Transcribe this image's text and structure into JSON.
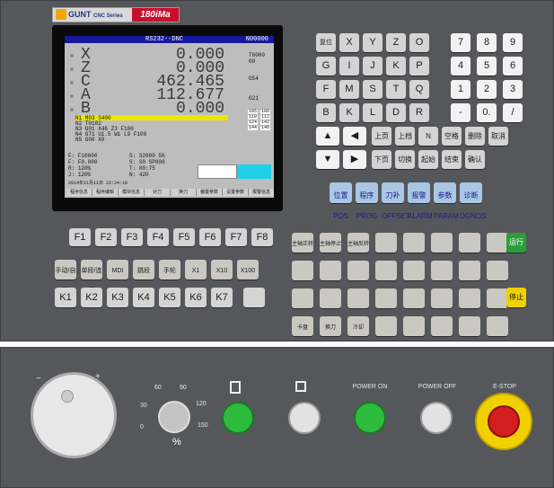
{
  "brand": {
    "maker": "GUNT",
    "series": "CNC Series",
    "model": "180iMa"
  },
  "screen": {
    "title": "RS232--DNC",
    "program": "N00000",
    "axes": [
      {
        "name": "X",
        "value": "0.000"
      },
      {
        "name": "Z",
        "value": "0.000"
      },
      {
        "name": "C",
        "value": "462.465"
      },
      {
        "name": "A",
        "value": "112.677"
      },
      {
        "name": "B",
        "value": "0.000"
      }
    ],
    "t_code": "T0000 00",
    "g54": "G54",
    "g21": "G21",
    "program_lines": [
      "N1 M03 S400",
      "N2 T0102",
      "N3 G01 X46 Z3 F100",
      "N4 G71 U1.5 W1 L9 F100",
      "N5 G00 X0"
    ],
    "m_codes": [
      "105",
      "106",
      "110",
      "112",
      "124",
      "142",
      "144",
      "146"
    ],
    "feed": "F10000",
    "feed2": "F0.000",
    "speed": "S2000",
    "speed2": "S0",
    "override": "5%",
    "spoverride": "SP000",
    "rapid": "120%",
    "jog": "120%",
    "time": "00:75",
    "parts": "420",
    "datetime": "2014年11月11日 22:24:10",
    "softkeys": [
      "程序信息",
      "程序编辑",
      "模块信息",
      "对刀",
      "换刀",
      "偏置参数",
      "设置参数",
      "报警信息"
    ]
  },
  "address_keys": [
    [
      "复位RESET",
      "X",
      "Y",
      "Z",
      "O",
      "7",
      "8",
      "9"
    ],
    [
      "G",
      "I",
      "J",
      "K",
      "P",
      "4",
      "5",
      "6"
    ],
    [
      "F",
      "M",
      "S",
      "T",
      "Q",
      "1",
      "2",
      "3"
    ],
    [
      "B",
      "K",
      "L",
      "D",
      "R",
      "-",
      "0.",
      "/"
    ]
  ],
  "edit_keys": [
    [
      "上页",
      "上档",
      "N",
      "空格",
      "删除",
      "取消"
    ],
    [
      "下页",
      "切换",
      "起始",
      "结束",
      "确认"
    ]
  ],
  "func_keys": [
    "位置POS",
    "程序PROG",
    "刀补OFFSET",
    "报警ALARM",
    "参数PARAM",
    "诊断DGNOS"
  ],
  "fkeys": [
    "F1",
    "F2",
    "F3",
    "F4",
    "F5",
    "F6",
    "F7",
    "F8"
  ],
  "mode_keys": [
    "手动/自动",
    "单段/连续",
    "MDI",
    "跳段",
    "手轮",
    "X1",
    "X10",
    "X100"
  ],
  "kkeys": [
    "K1",
    "K2",
    "K3",
    "K4",
    "K5",
    "K6",
    "K7"
  ],
  "machine_keys": [
    "主轴正转",
    "主轴停止",
    "主轴反转",
    "运行",
    "停止",
    "卡盘",
    "换刀",
    "冷却"
  ],
  "bottom": {
    "override_label": "%",
    "scale": [
      "60",
      "90",
      "120",
      "150",
      "30",
      "0"
    ],
    "power_on": "POWER ON",
    "power_off": "POWER OFF",
    "estop": "E-STOP"
  }
}
